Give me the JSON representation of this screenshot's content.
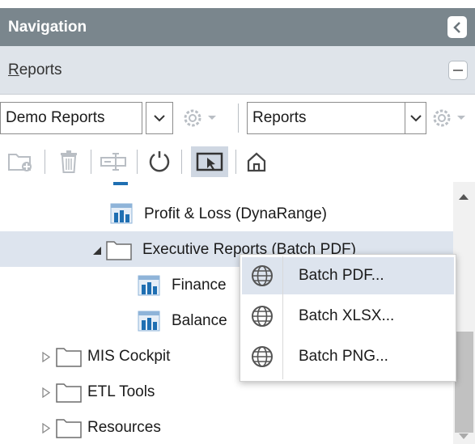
{
  "navigation": {
    "title": "Navigation",
    "collapse_icon": "chevron-left-icon"
  },
  "reports_section": {
    "title_first": "R",
    "title_rest": "eports",
    "minimize_icon": "minus-icon"
  },
  "dropdowns": {
    "left": {
      "value": "Demo Reports"
    },
    "right": {
      "value": "Reports"
    }
  },
  "toolbar": {
    "icons": [
      "new-folder-icon",
      "delete-icon",
      "rename-icon",
      "refresh-icon",
      "select-icon",
      "home-icon"
    ]
  },
  "tree": {
    "items": [
      {
        "label": "Profit & Loss (DynaRange)",
        "type": "report"
      },
      {
        "label": "Executive Reports (Batch PDF)",
        "type": "folder",
        "expanded": true,
        "selected": true
      },
      {
        "label": "Finance",
        "type": "report"
      },
      {
        "label": "Balance",
        "type": "report"
      },
      {
        "label": "MIS Cockpit",
        "type": "folder",
        "expanded": false
      },
      {
        "label": "ETL Tools",
        "type": "folder",
        "expanded": false
      },
      {
        "label": "Resources",
        "type": "folder",
        "expanded": false
      }
    ]
  },
  "context_menu": {
    "items": [
      {
        "label": "Batch PDF...",
        "icon": "globe-icon",
        "highlighted": true
      },
      {
        "label": "Batch XLSX...",
        "icon": "globe-icon",
        "highlighted": false
      },
      {
        "label": "Batch PNG...",
        "icon": "globe-icon",
        "highlighted": false
      }
    ]
  },
  "colors": {
    "header_bg": "#7a868d",
    "section_bg": "#dfe4ea",
    "selection_bg": "#dde4ee",
    "report_icon_blue": "#1f6fb2"
  }
}
